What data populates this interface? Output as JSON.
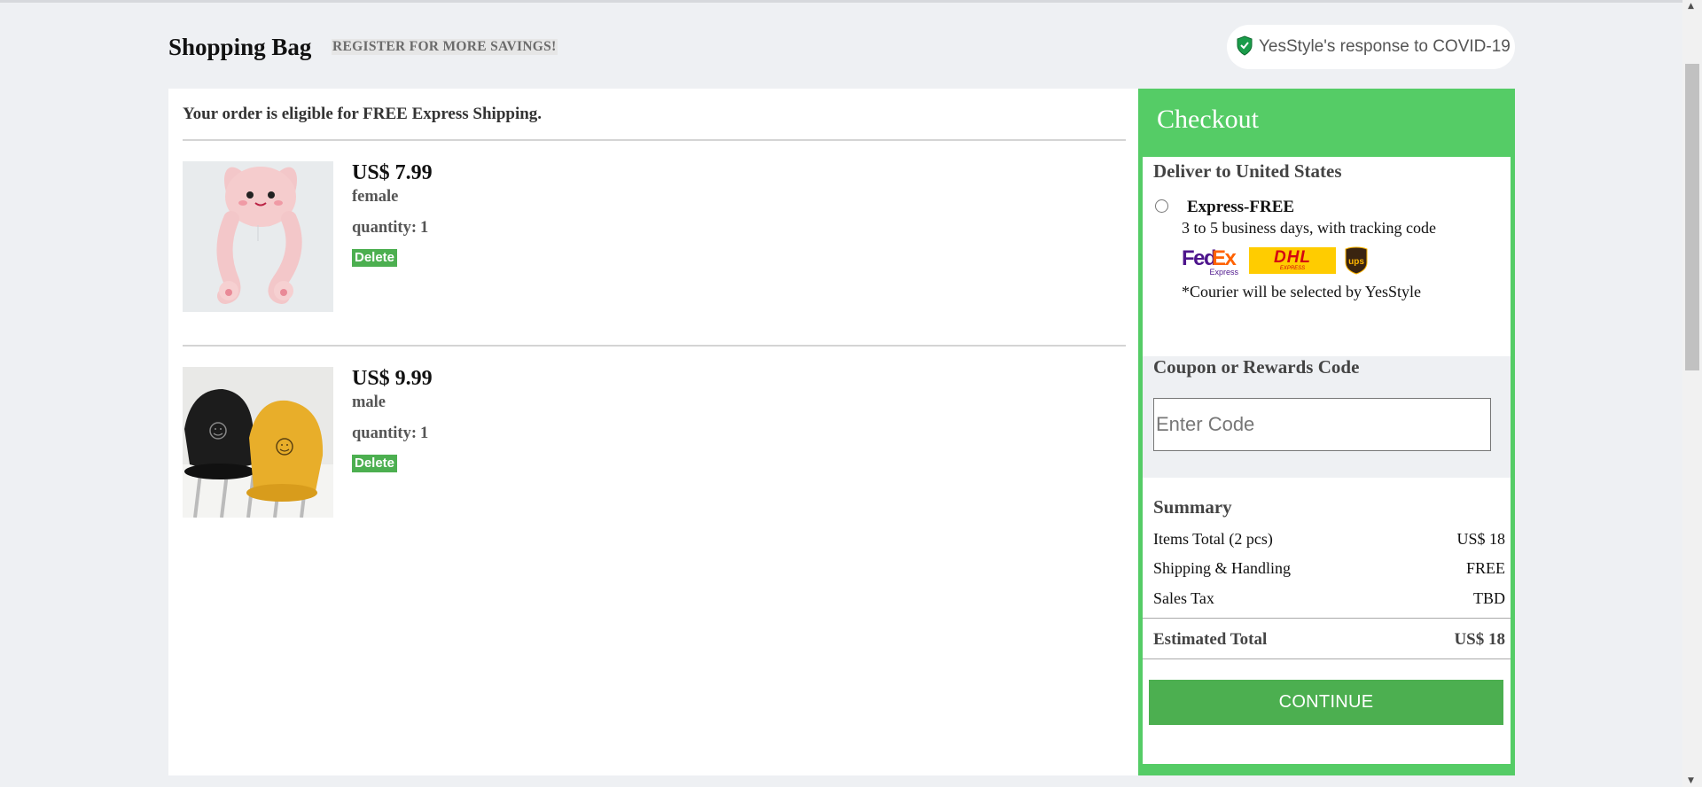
{
  "header": {
    "title": "Shopping Bag",
    "register_link": "REGISTER FOR MORE SAVINGS!",
    "covid_link": "YesStyle's response to COVID-19",
    "covid_icon": "shield-icon"
  },
  "bag": {
    "shipping_note": "Your order is eligible for FREE Express Shipping.",
    "quantity_label": "quantity:",
    "items": [
      {
        "price": "US$ 7.99",
        "variant": "female",
        "quantity": "1",
        "delete_label": "Delete",
        "image": "pink-bunny-ear-hat"
      },
      {
        "price": "US$ 9.99",
        "variant": "male",
        "quantity": "1",
        "delete_label": "Delete",
        "image": "smiley-face-caps"
      }
    ]
  },
  "checkout": {
    "title": "Checkout",
    "deliver_title": "Deliver to United States",
    "express_label": "Express-FREE",
    "express_sub": "3 to 5 business days, with tracking code",
    "couriers": {
      "fedex_fe": "Fed",
      "fedex_ex": "Ex",
      "fedex_sub": "Express",
      "dhl": "DHL",
      "dhl_sub": "EXPRESS",
      "ups": "ups"
    },
    "courier_note": "*Courier will be selected by YesStyle",
    "coupon_title": "Coupon or Rewards Code",
    "coupon_placeholder": "Enter Code",
    "summary_title": "Summary",
    "summary_rows": [
      {
        "label": "Items Total (2 pcs)",
        "value": "US$ 18"
      },
      {
        "label": "Shipping & Handling",
        "value": "FREE"
      },
      {
        "label": "Sales Tax",
        "value": "TBD"
      }
    ],
    "estimated_label": "Estimated Total",
    "estimated_value": "US$ 18",
    "continue_label": "CONTINUE"
  },
  "colors": {
    "accent_green": "#55cc66",
    "button_green": "#4caf50",
    "page_bg": "#eef0f3"
  }
}
